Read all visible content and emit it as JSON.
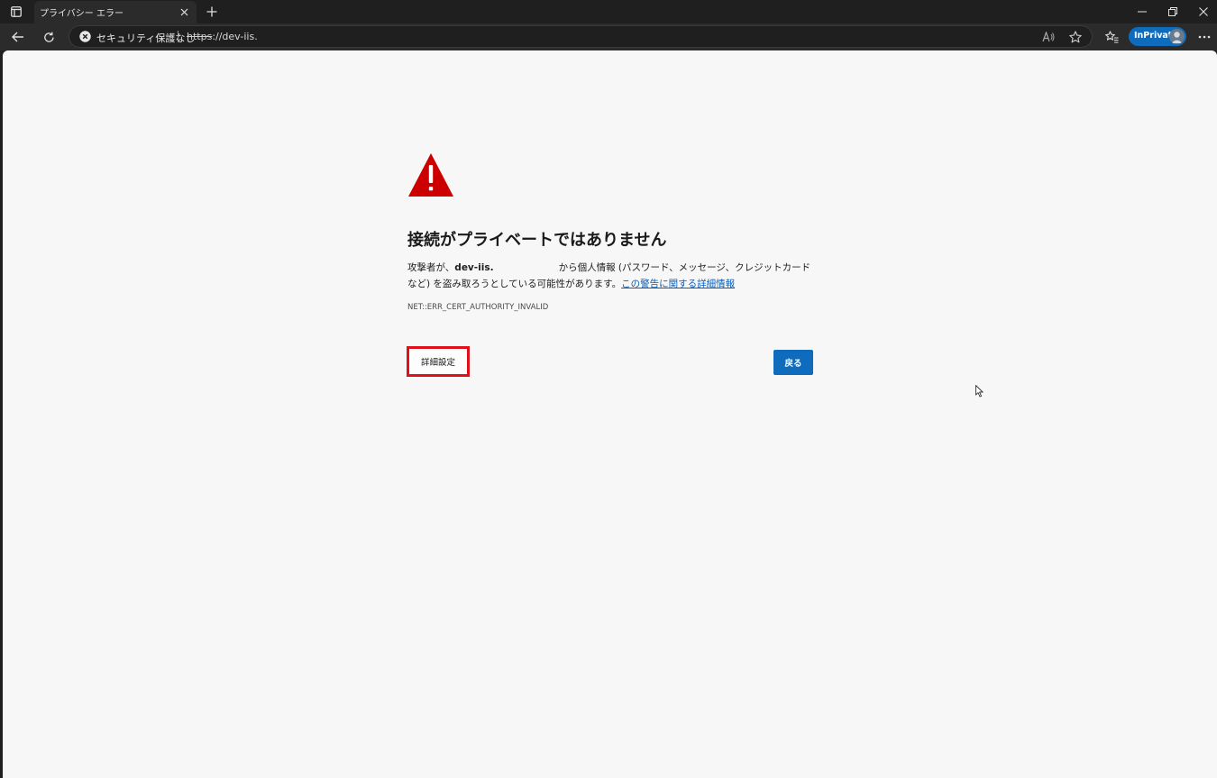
{
  "browser": {
    "tab": {
      "title": "プライバシー エラー"
    },
    "address_bar": {
      "security_label": "セキュリティ保護なし",
      "url_scheme": "https",
      "url_rest": "://dev-iis."
    },
    "inprivate_label": "InPrivate"
  },
  "page": {
    "heading": "接続がプライベートではありません",
    "desc_prefix": "攻撃者が、",
    "desc_host": "dev-iis.",
    "desc_after_host": "から個人情報 (パスワード、メッセージ、クレジットカード",
    "desc_line2": "など) を盗み取ろうとしている可能性があります。",
    "learn_more_link": "この警告に関する詳細情報",
    "error_code": "NET::ERR_CERT_AUTHORITY_INVALID",
    "advanced_button": "詳細設定",
    "back_button": "戻る"
  },
  "colors": {
    "accent": "#0f6cbd",
    "warning": "#cc0000",
    "highlight_box": "#e0101a"
  }
}
